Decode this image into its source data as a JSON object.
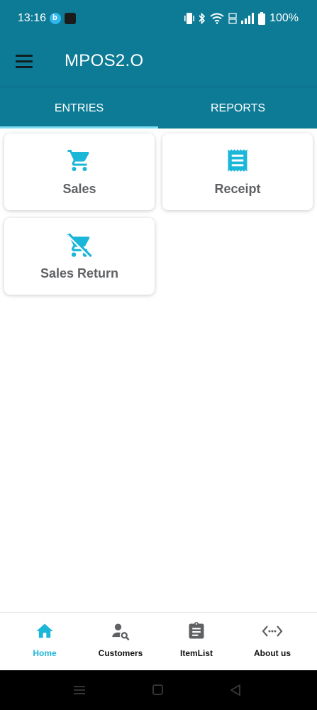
{
  "status_bar": {
    "time": "13:16",
    "app_icon_1_letter": "b",
    "battery": "100%"
  },
  "app_bar": {
    "title": "MPOS2.O"
  },
  "tabs": [
    {
      "label": "ENTRIES",
      "selected": true
    },
    {
      "label": "REPORTS",
      "selected": false
    }
  ],
  "cards": [
    {
      "label": "Sales",
      "icon": "cart-icon"
    },
    {
      "label": "Receipt",
      "icon": "receipt-icon"
    },
    {
      "label": "Sales Return",
      "icon": "cart-off-icon"
    }
  ],
  "bottom_nav": [
    {
      "label": "Home",
      "icon": "home-icon",
      "active": true
    },
    {
      "label": "Customers",
      "icon": "person-search-icon",
      "active": false
    },
    {
      "label": "ItemList",
      "icon": "clipboard-icon",
      "active": false
    },
    {
      "label": "About us",
      "icon": "code-dots-icon",
      "active": false
    }
  ],
  "colors": {
    "primary": "#0e7b96",
    "accent": "#1cb6d8",
    "tab_indicator": "#7fdcf0",
    "card_text": "#5f6164"
  }
}
